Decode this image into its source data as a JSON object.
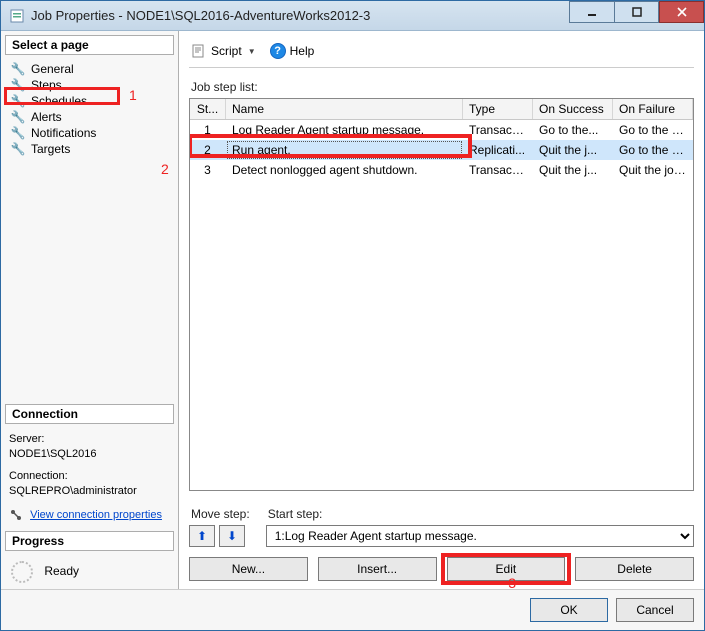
{
  "titlebar": {
    "title": "Job Properties - NODE1\\SQL2016-AdventureWorks2012-3"
  },
  "left": {
    "select_page_header": "Select a page",
    "pages": {
      "general": "General",
      "steps": "Steps",
      "schedules": "Schedules",
      "alerts": "Alerts",
      "notifications": "Notifications",
      "targets": "Targets"
    },
    "connection_header": "Connection",
    "server_label": "Server:",
    "server_value": "NODE1\\SQL2016",
    "connection_label": "Connection:",
    "connection_value": "SQLREPRO\\administrator",
    "view_conn_props": "View connection properties",
    "progress_header": "Progress",
    "progress_status": "Ready"
  },
  "toolbar": {
    "script": "Script",
    "help": "Help"
  },
  "main": {
    "list_label": "Job step list:",
    "columns": {
      "st": "St...",
      "name": "Name",
      "type": "Type",
      "succ": "On Success",
      "fail": "On Failure"
    },
    "rows": [
      {
        "st": "1",
        "name": "Log Reader Agent startup message.",
        "type": "Transact-...",
        "succ": "Go to the...",
        "fail": "Go to the n..."
      },
      {
        "st": "2",
        "name": "Run agent.",
        "type": "Replicati...",
        "succ": "Quit the j...",
        "fail": "Go to the n..."
      },
      {
        "st": "3",
        "name": "Detect nonlogged agent shutdown.",
        "type": "Transact-...",
        "succ": "Quit the j...",
        "fail": "Quit the job..."
      }
    ],
    "move_label": "Move step:",
    "start_label": "Start step:",
    "start_value": "1:Log Reader Agent startup message.",
    "buttons": {
      "new": "New...",
      "insert": "Insert...",
      "edit": "Edit",
      "delete": "Delete"
    }
  },
  "footer": {
    "ok": "OK",
    "cancel": "Cancel"
  },
  "annotations": {
    "one": "1",
    "two": "2",
    "three": "3"
  }
}
